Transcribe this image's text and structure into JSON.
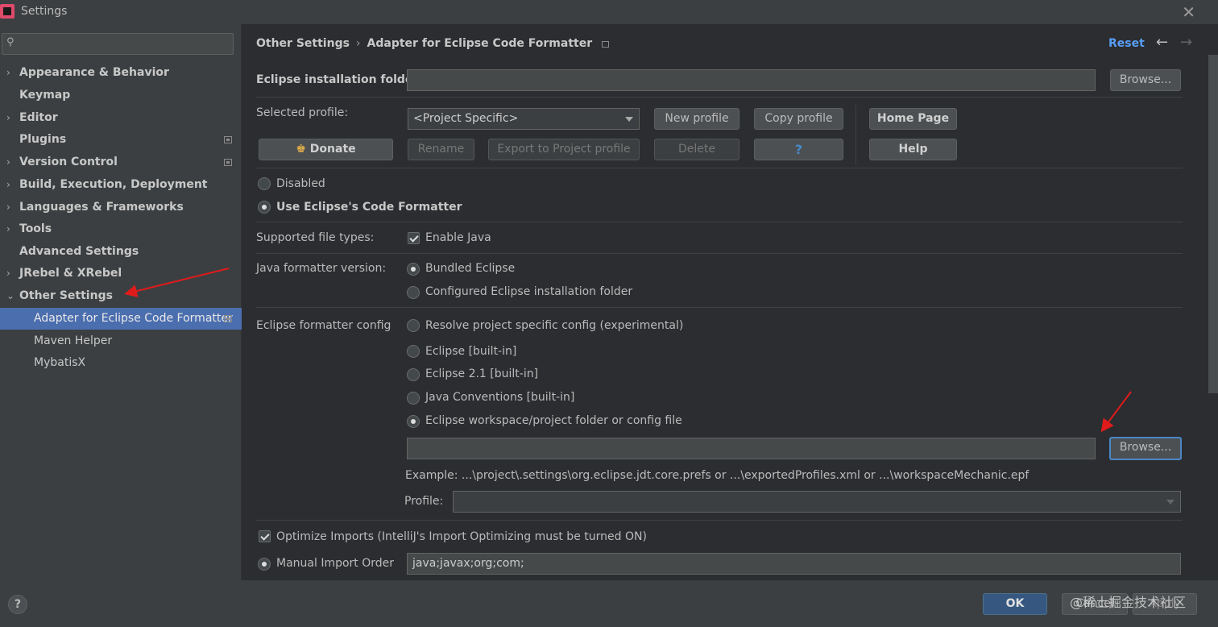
{
  "window": {
    "title": "Settings",
    "close_glyph": "✕"
  },
  "sidebar": {
    "search_placeholder": "",
    "items": [
      {
        "label": "Appearance & Behavior",
        "chev": "›"
      },
      {
        "label": "Keymap",
        "chev": ""
      },
      {
        "label": "Editor",
        "chev": "›"
      },
      {
        "label": "Plugins",
        "chev": ""
      },
      {
        "label": "Version Control",
        "chev": "›"
      },
      {
        "label": "Build, Execution, Deployment",
        "chev": "›"
      },
      {
        "label": "Languages & Frameworks",
        "chev": "›"
      },
      {
        "label": "Tools",
        "chev": "›"
      },
      {
        "label": "Advanced Settings",
        "chev": ""
      },
      {
        "label": "JRebel & XRebel",
        "chev": "›"
      },
      {
        "label": "Other Settings",
        "chev": "⌄"
      },
      {
        "label": "Adapter for Eclipse Code Formatter",
        "chev": ""
      },
      {
        "label": "Maven Helper",
        "chev": ""
      },
      {
        "label": "MybatisX",
        "chev": ""
      }
    ]
  },
  "header": {
    "crumb1": "Other Settings",
    "sep": "›",
    "crumb2": "Adapter for Eclipse Code Formatter",
    "reset": "Reset",
    "back": "←",
    "forward": "→"
  },
  "form": {
    "install_folder_label": "Eclipse installation folder",
    "install_folder_value": "",
    "browse1": "Browse...",
    "selected_profile_label": "Selected profile:",
    "profile_value": "<Project Specific>",
    "new_profile": "New profile",
    "copy_profile": "Copy profile",
    "home_page": "Home Page",
    "donate": "Donate",
    "rename": "Rename",
    "export": "Export to Project profile",
    "delete": "Delete",
    "question": "?",
    "help": "Help",
    "disabled": "Disabled",
    "use_eclipse": "Use Eclipse's Code Formatter",
    "supported_types_label": "Supported file types:",
    "enable_java": "Enable Java",
    "java_version_label": "Java formatter version:",
    "bundled": "Bundled Eclipse",
    "configured": "Configured Eclipse installation folder",
    "config_label": "Eclipse formatter config",
    "opt_resolve": "Resolve project specific config (experimental)",
    "opt_builtin": "Eclipse [built-in]",
    "opt_21": "Eclipse 2.1 [built-in]",
    "opt_java_conv": "Java Conventions [built-in]",
    "opt_workspace": "Eclipse workspace/project folder or config file",
    "config_path_value": "",
    "browse2": "Browse...",
    "example": "Example: ...\\project\\.settings\\org.eclipse.jdt.core.prefs or ...\\exportedProfiles.xml or ...\\workspaceMechanic.epf",
    "profile_label": "Profile:",
    "profile2_value": "",
    "optimize_imports": "Optimize Imports  (IntelliJ's Import Optimizing must be turned ON)",
    "manual_order": "Manual Import Order",
    "import_order_value": "java;javax;org;com;"
  },
  "bottom": {
    "help": "?",
    "ok": "OK",
    "cancel": "Cancel",
    "apply": "Apply",
    "watermark": "@稀土掘金技术社区"
  }
}
